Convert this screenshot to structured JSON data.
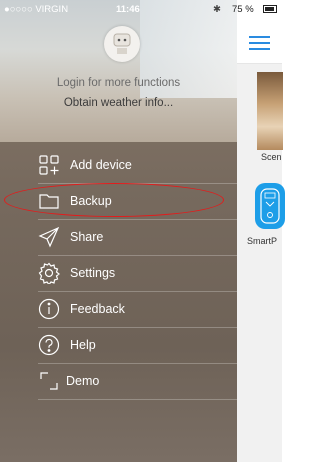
{
  "status_bar": {
    "carrier": "●○○○○ VIRGIN",
    "time": "11:46",
    "battery": "75 %",
    "bluetooth": "✱"
  },
  "drawer": {
    "login_text": "Login for more functions",
    "weather_text": "Obtain weather info...",
    "menu": [
      {
        "label": "Add device",
        "icon": "add-device-icon"
      },
      {
        "label": "Backup",
        "icon": "folder-icon"
      },
      {
        "label": "Share",
        "icon": "share-icon"
      },
      {
        "label": "Settings",
        "icon": "gear-icon"
      },
      {
        "label": "Feedback",
        "icon": "info-icon"
      },
      {
        "label": "Help",
        "icon": "help-icon"
      },
      {
        "label": "Demo",
        "icon": "demo-icon"
      }
    ],
    "highlighted_item": "Backup"
  },
  "main": {
    "scene_label": "Scen",
    "smart_label": "SmartP"
  },
  "colors": {
    "accent": "#1d9ee8",
    "highlight": "#e21c1c"
  }
}
